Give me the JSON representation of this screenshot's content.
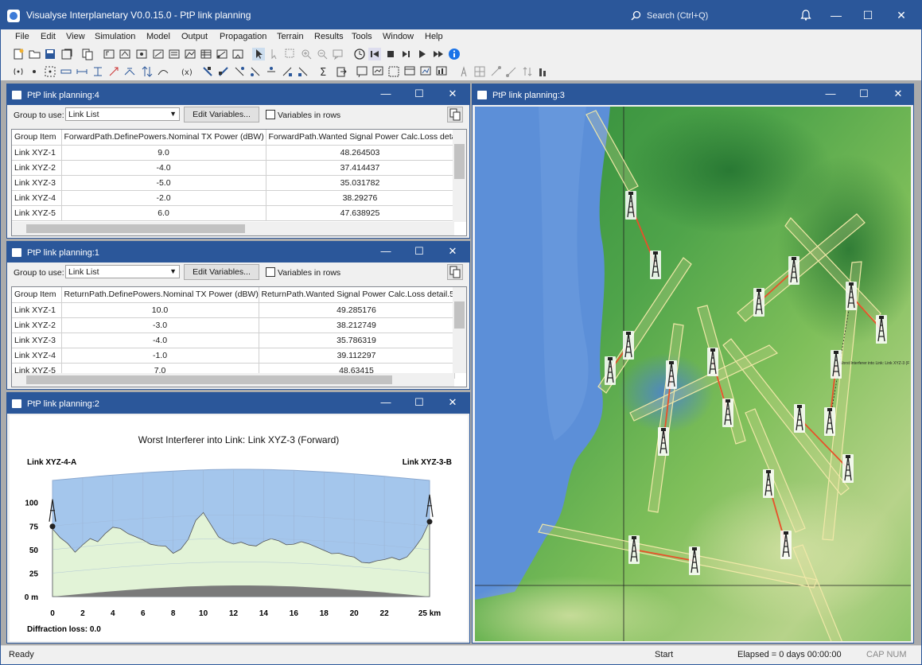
{
  "app": {
    "title": "Visualyse Interplanetary V0.0.15.0 - PtP link planning",
    "search_placeholder": "Search (Ctrl+Q)"
  },
  "menu": [
    "File",
    "Edit",
    "View",
    "Simulation",
    "Model",
    "Output",
    "Propagation",
    "Terrain",
    "Results",
    "Tools",
    "Window",
    "Help"
  ],
  "win4": {
    "title": "PtP link planning:4",
    "group_label": "Group to use:",
    "group_value": "Link List",
    "edit_button": "Edit Variables...",
    "rows_label": "Variables in rows",
    "headers": [
      "Group Item",
      "ForwardPath.DefinePowers.Nominal TX Power (dBW)",
      "ForwardPath.Wanted Signal Power Calc.Loss detai"
    ],
    "rows": [
      [
        "Link XYZ-1",
        "9.0",
        "48.264503"
      ],
      [
        "Link XYZ-2",
        "-4.0",
        "37.414437"
      ],
      [
        "Link XYZ-3",
        "-5.0",
        "35.031782"
      ],
      [
        "Link XYZ-4",
        "-2.0",
        "38.29276"
      ],
      [
        "Link XYZ-5",
        "6.0",
        "47.638925"
      ]
    ]
  },
  "win1": {
    "title": "PtP link planning:1",
    "group_label": "Group to use:",
    "group_value": "Link List",
    "edit_button": "Edit Variables...",
    "rows_label": "Variables in rows",
    "headers": [
      "Group Item",
      "ReturnPath.DefinePowers.Nominal TX Power (dBW)",
      "ReturnPath.Wanted Signal Power Calc.Loss detail.5"
    ],
    "rows": [
      [
        "Link XYZ-1",
        "10.0",
        "49.285176"
      ],
      [
        "Link XYZ-2",
        "-3.0",
        "38.212749"
      ],
      [
        "Link XYZ-3",
        "-4.0",
        "35.786319"
      ],
      [
        "Link XYZ-4",
        "-1.0",
        "39.112297"
      ],
      [
        "Link XYZ-5",
        "7.0",
        "48.63415"
      ]
    ]
  },
  "win2": {
    "title": "PtP link planning:2",
    "chart_data": {
      "type": "area",
      "title": "Worst Interferer into Link: Link XYZ-3 (Forward)",
      "left_station": "Link XYZ-4-A",
      "right_station": "Link XYZ-3-B",
      "footer": "Diffraction loss: 0.0",
      "xlabel": "",
      "ylabel": "",
      "x_ticks": [
        "0",
        "2",
        "4",
        "6",
        "8",
        "10",
        "12",
        "14",
        "16",
        "18",
        "20",
        "22",
        "25 km"
      ],
      "y_ticks": [
        "0 m",
        "25",
        "50",
        "75",
        "100"
      ],
      "xlim": [
        0,
        25
      ],
      "ylim": [
        0,
        115
      ],
      "terrain_km": [
        0,
        0.5,
        1,
        1.5,
        2,
        2.5,
        3,
        3.5,
        4,
        4.5,
        5,
        5.5,
        6,
        6.5,
        7,
        7.5,
        8,
        8.5,
        9,
        9.5,
        10,
        10.5,
        11,
        11.5,
        12,
        12.5,
        13,
        13.5,
        14,
        14.5,
        15,
        15.5,
        16,
        16.5,
        17,
        17.5,
        18,
        18.5,
        19,
        19.5,
        20,
        20.5,
        21,
        21.5,
        22,
        22.5,
        23,
        23.5,
        24,
        24.5,
        25
      ],
      "terrain_m": [
        72,
        62,
        55,
        45,
        52,
        58,
        54,
        62,
        68,
        66,
        60,
        56,
        52,
        47,
        45,
        44,
        36,
        40,
        50,
        70,
        78,
        65,
        52,
        47,
        44,
        46,
        43,
        42,
        47,
        50,
        48,
        44,
        45,
        48,
        46,
        43,
        40,
        37,
        38,
        36,
        35,
        30,
        30,
        33,
        35,
        38,
        36,
        40,
        50,
        62,
        80
      ],
      "tx_height": 100,
      "rx_height": 105
    }
  },
  "win3": {
    "title": "PtP link planning:3",
    "map_label": "Worst Interferer into Link: Link XYZ-3 (F"
  },
  "status": {
    "left": "Ready",
    "center": "Start",
    "elapsed": "Elapsed = 0 days 00:00:00",
    "caps": "CAP NUM"
  },
  "colors": {
    "accent": "#2b579a",
    "sky": "#a4c6ec",
    "terrain": "#e2f3d7",
    "link": "#e8502a"
  }
}
